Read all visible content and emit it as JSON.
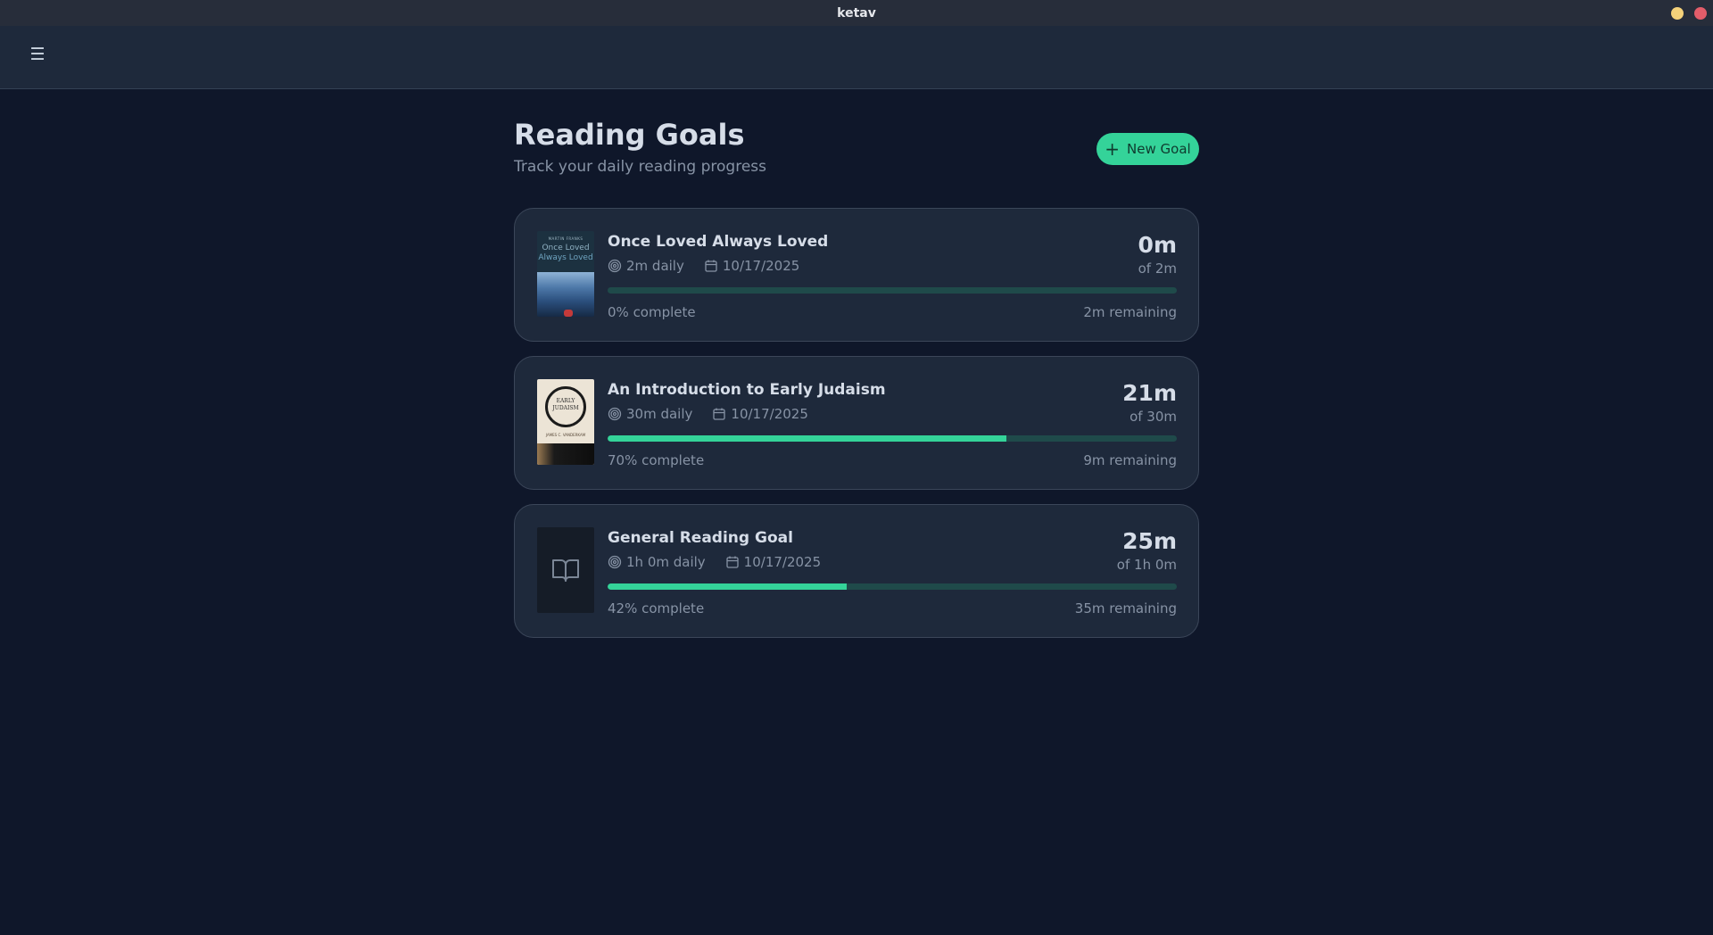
{
  "window": {
    "title": "ketav"
  },
  "topbar": {
    "menu_icon": "☰"
  },
  "header": {
    "title": "Reading Goals",
    "subtitle": "Track your daily reading progress",
    "new_goal_label": "New Goal",
    "new_goal_icon": "+"
  },
  "colors": {
    "accent": "#34d399",
    "background": "#0f172a",
    "card": "#1e293b",
    "track": "#1f4a4a"
  },
  "goals": [
    {
      "title": "Once Loved Always Loved",
      "daily": "2m daily",
      "date": "10/17/2025",
      "progress_value": "0m",
      "progress_of": "of 2m",
      "percent": 0,
      "percent_label": "0% complete",
      "remaining": "2m remaining",
      "cover": {
        "author": "MARTIN FRANKS",
        "title_line1": "Once Loved",
        "title_line2": "Always Loved"
      }
    },
    {
      "title": "An Introduction to Early Judaism",
      "daily": "30m daily",
      "date": "10/17/2025",
      "progress_value": "21m",
      "progress_of": "of 30m",
      "percent": 70,
      "percent_label": "70% complete",
      "remaining": "9m remaining",
      "cover": {
        "title_line1": "EARLY",
        "title_line2": "JUDAISM",
        "author": "JAMES C. VANDERKAM"
      }
    },
    {
      "title": "General Reading Goal",
      "daily": "1h 0m daily",
      "date": "10/17/2025",
      "progress_value": "25m",
      "progress_of": "of 1h 0m",
      "percent": 42,
      "percent_label": "42% complete",
      "remaining": "35m remaining",
      "cover": {
        "icon": "book-open-icon"
      }
    }
  ]
}
